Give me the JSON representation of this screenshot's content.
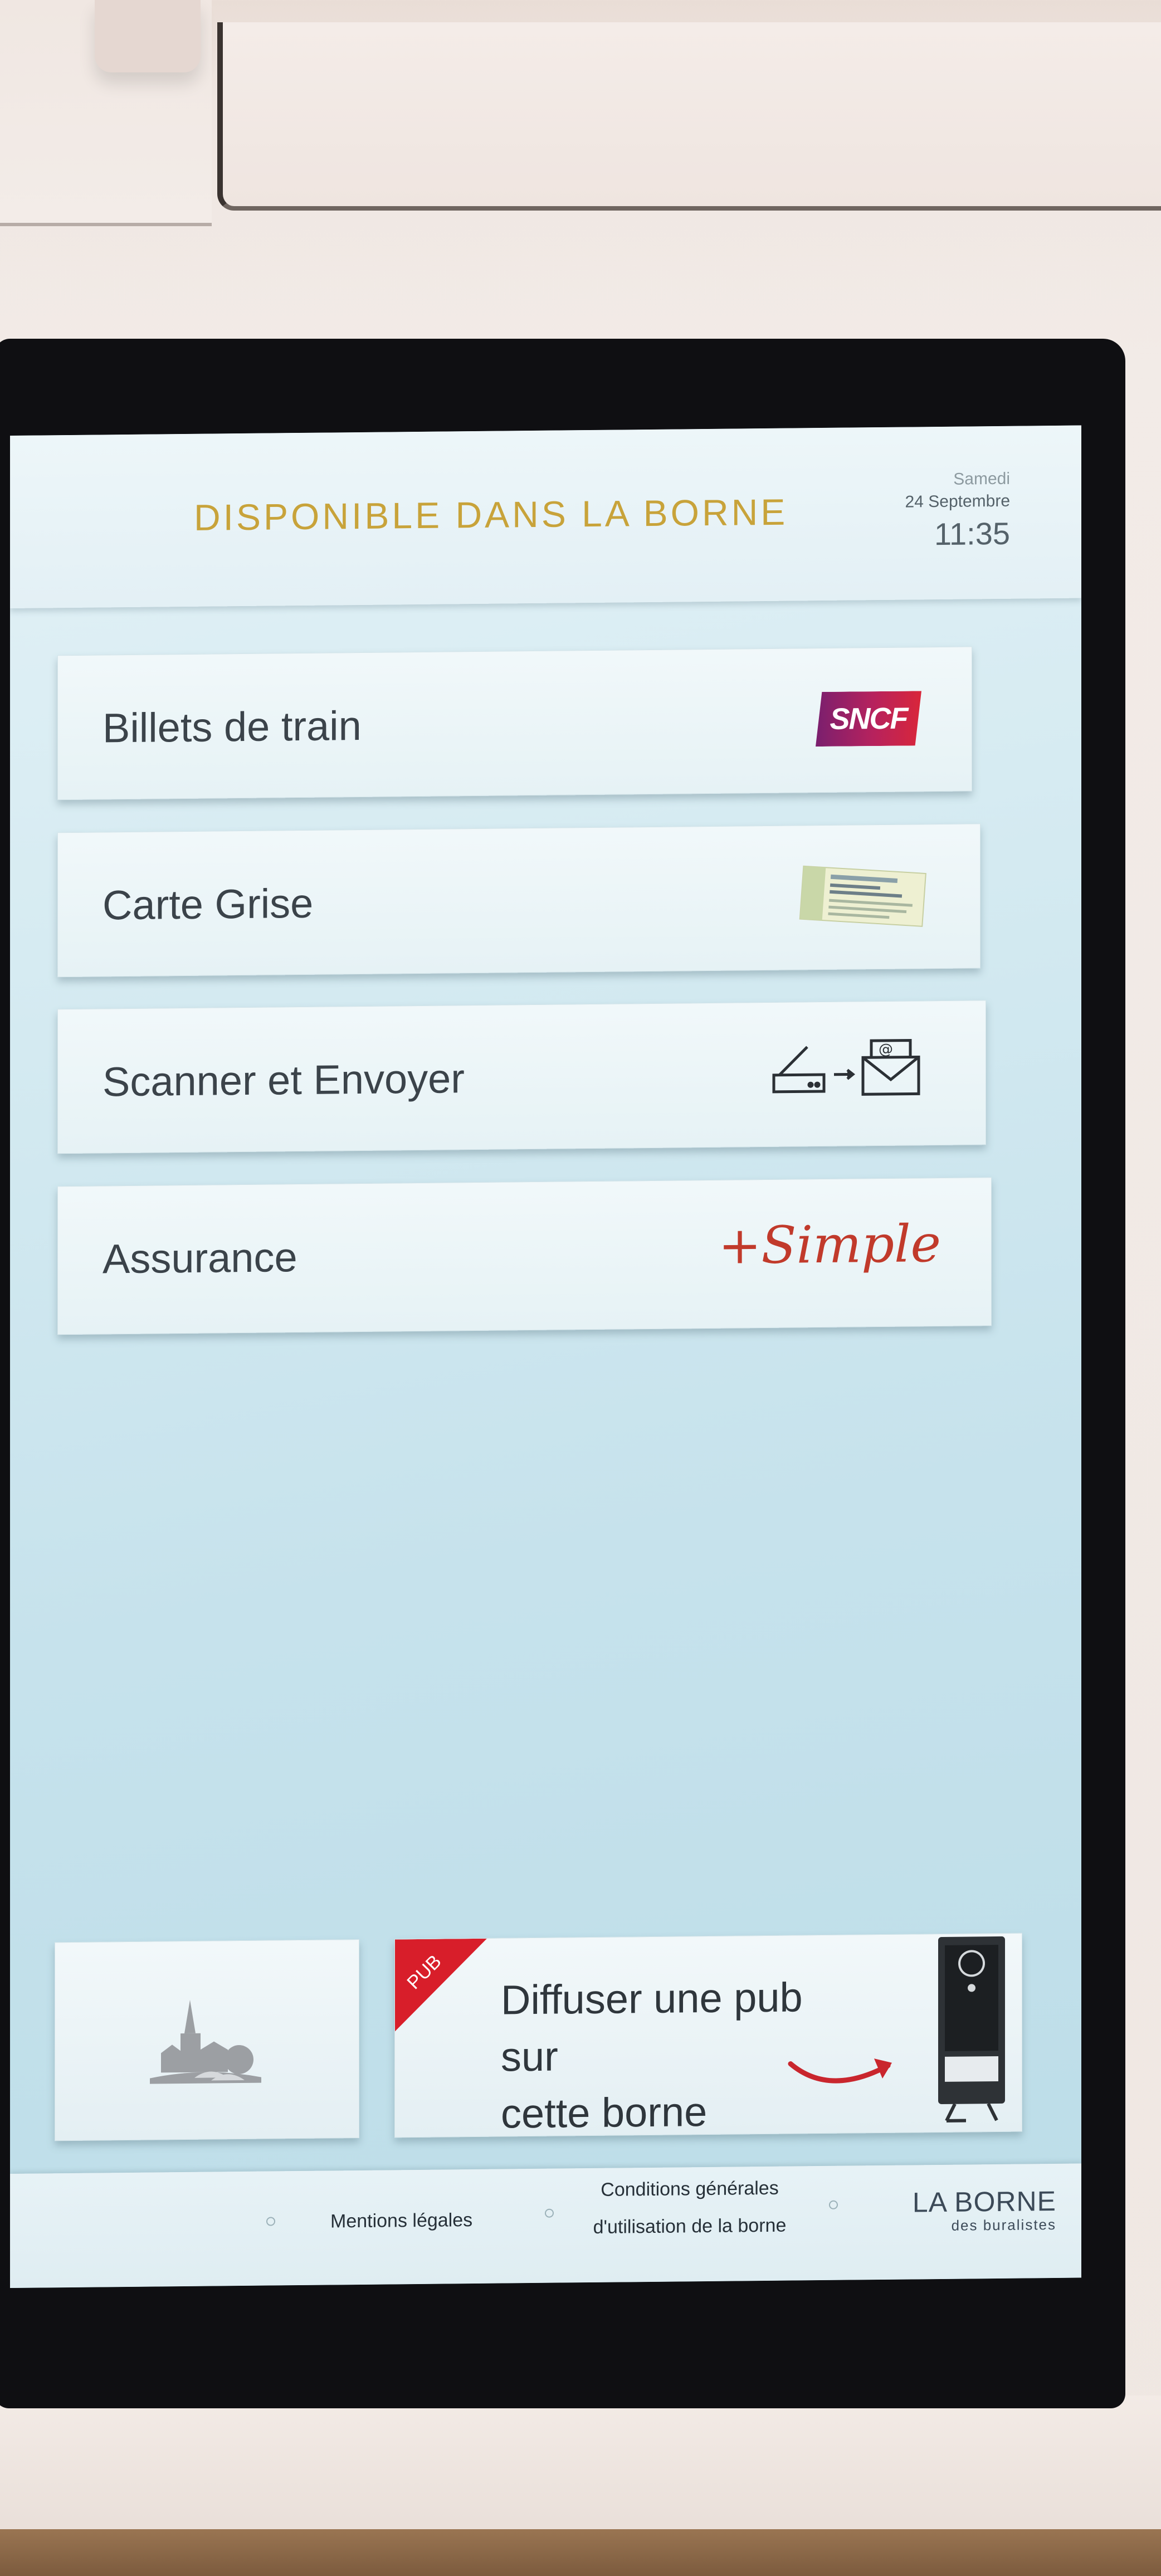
{
  "header": {
    "title": "DISPONIBLE DANS LA BORNE",
    "day": "Samedi",
    "date": "24 Septembre",
    "time": "11:35"
  },
  "menu": [
    {
      "label": "Billets de train",
      "logo": "sncf-logo",
      "logo_text": "SNCF"
    },
    {
      "label": "Carte Grise",
      "logo": "vehicle-registration-document-icon"
    },
    {
      "label": "Scanner et Envoyer",
      "logo": "scanner-to-email-icon"
    },
    {
      "label": "Assurance",
      "logo": "plus-simple-logo",
      "logo_text": "+Simple"
    }
  ],
  "tiles": {
    "village_icon": "village-church-icon",
    "pub_badge": "PUB",
    "pub_text_line1": "Diffuser une pub sur",
    "pub_text_line2": "cette borne",
    "pub_arrow_icon": "red-curved-arrow-icon",
    "pub_kiosk_icon": "kiosk-terminal-icon"
  },
  "footer": {
    "mentions": "Mentions légales",
    "conditions_line1": "Conditions générales",
    "conditions_line2": "d'utilisation de la borne",
    "brand_line1": "LA BORNE",
    "brand_line2": "des buralistes"
  },
  "colors": {
    "title_gold": "#c8a33a",
    "sncf_purple": "#7a1f6e",
    "sncf_red": "#d9263a",
    "plus_simple_red": "#c13a2b",
    "pub_red": "#d81e2a"
  }
}
